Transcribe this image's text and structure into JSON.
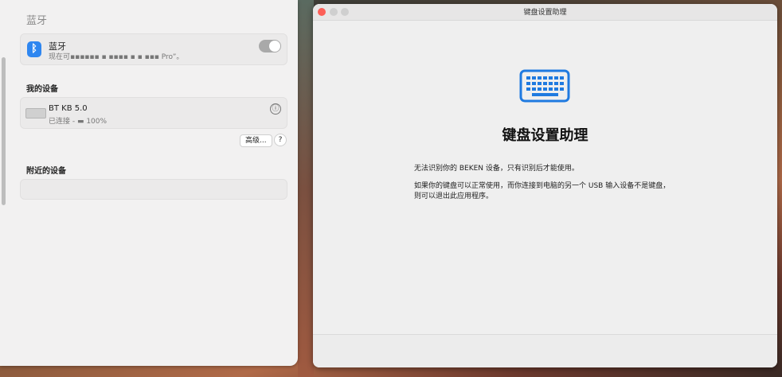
{
  "settings": {
    "title": "蓝牙",
    "bluetooth": {
      "name": "蓝牙",
      "status": "现在可▪▪▪▪▪▪ ▪ ▪▪▪▪ ▪ ▪ ▪▪▪ Pro”。",
      "enabled": true
    },
    "my_devices_label": "我的设备",
    "device": {
      "name": "BT KB 5.0",
      "status": "已连接 - ▬ 100%",
      "info_icon": "ⓘ"
    },
    "advanced_label": "高级...",
    "help_label": "?",
    "nearby_label": "附近的设备"
  },
  "assistant": {
    "window_title": "键盘设置助理",
    "icon": "keyboard-icon",
    "heading": "键盘设置助理",
    "para1": "无法识别你的 BEKEN 设备，只有识别后才能使用。",
    "para2": "如果你的键盘可以正常使用，而你连接到电脑的另一个 USB 输入设备不是键盘，则可以退出此应用程序。"
  },
  "colors": {
    "accent": "#2e86f0",
    "close": "#fc5f57"
  }
}
